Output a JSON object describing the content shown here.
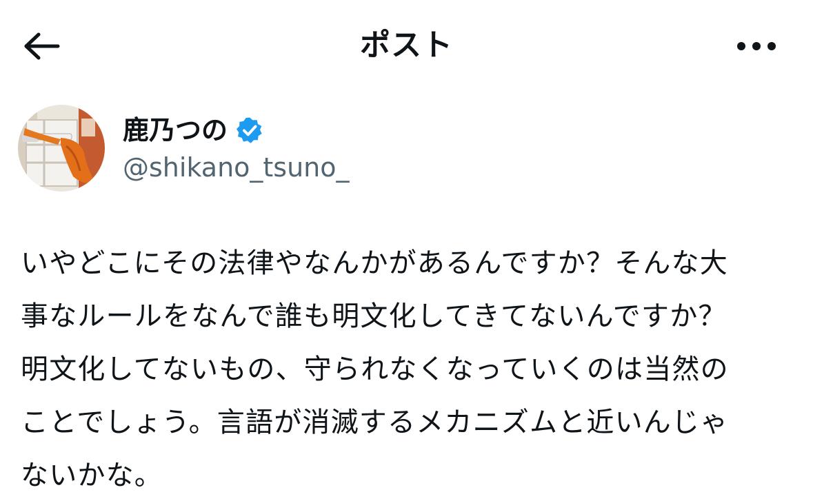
{
  "header": {
    "title": "ポスト",
    "back_icon": "arrow-left-icon",
    "more_icon": "more-horizontal-icon"
  },
  "author": {
    "display_name": "鹿乃つの",
    "handle": "@shikano_tsuno_",
    "verified_icon": "verified-badge-icon",
    "verified_color": "#1d9bf0"
  },
  "post": {
    "lines": [
      "いやどこにその法律やなんかがあるんですか？そんな大",
      "事なルールをなんで誰も明文化してきてないんですか？",
      "明文化してないもの、守られなくなっていくのは当然の",
      "ことでしょう。言語が消滅するメカニズムと近いんじゃ",
      "ないかな。"
    ]
  },
  "colors": {
    "text": "#0f1419",
    "secondary_text": "#536471",
    "background": "#ffffff"
  }
}
